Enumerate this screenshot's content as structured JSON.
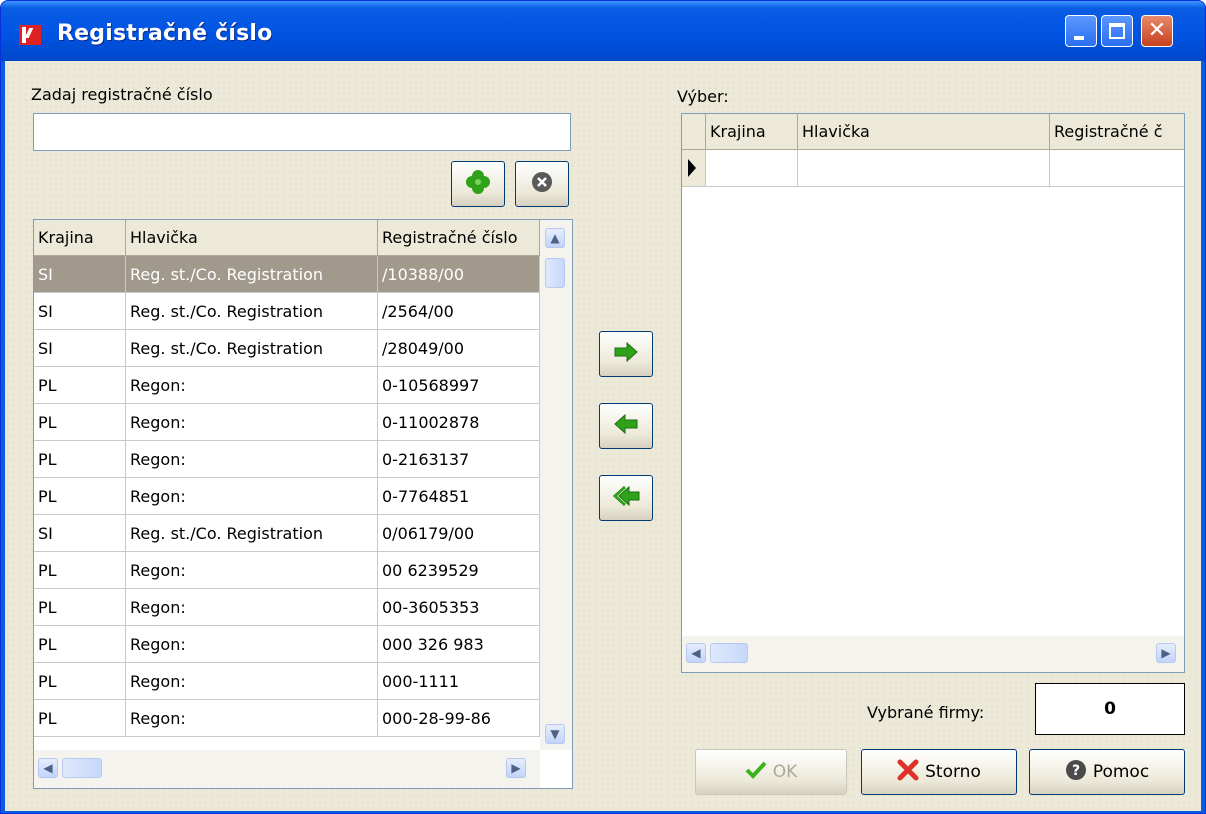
{
  "window": {
    "title": "Registračné číslo"
  },
  "left": {
    "input_label": "Zadaj registračné číslo",
    "input_value": "",
    "columns": [
      "Krajina",
      "Hlavička",
      "Registračné číslo"
    ],
    "rows": [
      {
        "krajina": "SI",
        "hlavicka": "Reg. st./Co. Registration",
        "reg": "/10388/00",
        "selected": true
      },
      {
        "krajina": "SI",
        "hlavicka": "Reg. st./Co. Registration",
        "reg": "/2564/00"
      },
      {
        "krajina": "SI",
        "hlavicka": "Reg. st./Co. Registration",
        "reg": "/28049/00"
      },
      {
        "krajina": "PL",
        "hlavicka": "Regon:",
        "reg": "0-10568997"
      },
      {
        "krajina": "PL",
        "hlavicka": "Regon:",
        "reg": "0-11002878"
      },
      {
        "krajina": "PL",
        "hlavicka": "Regon:",
        "reg": "0-2163137"
      },
      {
        "krajina": "PL",
        "hlavicka": "Regon:",
        "reg": "0-7764851"
      },
      {
        "krajina": "SI",
        "hlavicka": "Reg. st./Co. Registration",
        "reg": "0/06179/00"
      },
      {
        "krajina": "PL",
        "hlavicka": "Regon:",
        "reg": "00 6239529"
      },
      {
        "krajina": "PL",
        "hlavicka": "Regon:",
        "reg": "00-3605353"
      },
      {
        "krajina": "PL",
        "hlavicka": "Regon:",
        "reg": "000 326 983"
      },
      {
        "krajina": "PL",
        "hlavicka": "Regon:",
        "reg": "000-1111"
      },
      {
        "krajina": "PL",
        "hlavicka": "Regon:",
        "reg": "000-28-99-86"
      }
    ]
  },
  "right": {
    "label": "Výber:",
    "columns": [
      "Krajina",
      "Hlavička",
      "Registračné č"
    ],
    "selected_count_label": "Vybrané firmy:",
    "selected_count": "0"
  },
  "buttons": {
    "ok": "OK",
    "storno": "Storno",
    "pomoc": "Pomoc"
  },
  "colors": {
    "accent_green": "#2fa21a",
    "selected_row": "#a0998c",
    "title_blue": "#0054e3"
  }
}
